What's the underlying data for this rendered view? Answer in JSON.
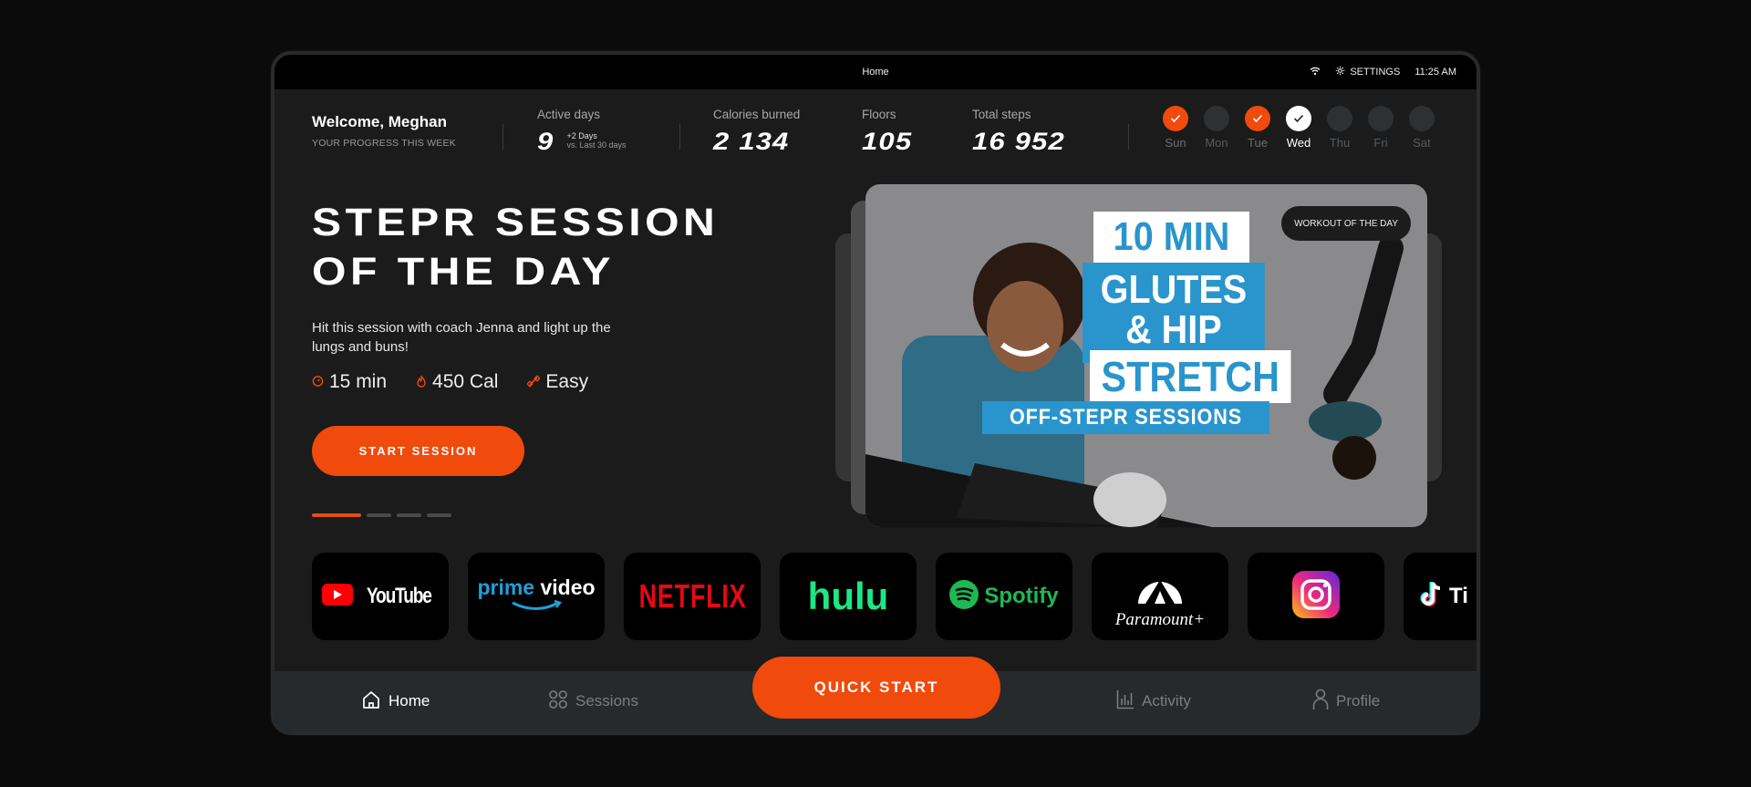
{
  "topbar": {
    "title": "Home",
    "wifi_icon": "wifi-icon",
    "settings_label": "SETTINGS",
    "time": "11:25 AM"
  },
  "welcome": {
    "greeting": "Welcome, Meghan",
    "subtitle": "YOUR PROGRESS THIS WEEK"
  },
  "stats": {
    "active_days": {
      "label": "Active days",
      "value": "9",
      "delta": "+2 Days",
      "compare": "vs. Last 30 days"
    },
    "calories": {
      "label": "Calories burned",
      "value": "2 134"
    },
    "floors": {
      "label": "Floors",
      "value": "105"
    },
    "steps": {
      "label": "Total steps",
      "value": "16 952"
    }
  },
  "week": [
    {
      "label": "Sun",
      "status": "done"
    },
    {
      "label": "Mon",
      "status": "none"
    },
    {
      "label": "Tue",
      "status": "done"
    },
    {
      "label": "Wed",
      "status": "today"
    },
    {
      "label": "Thu",
      "status": "none"
    },
    {
      "label": "Fri",
      "status": "none"
    },
    {
      "label": "Sat",
      "status": "none"
    }
  ],
  "hero": {
    "title_line1": "STEPR SESSION",
    "title_line2": "OF THE DAY",
    "description": "Hit this session with coach Jenna and light up the lungs and buns!",
    "duration": "15 min",
    "calories": "450 Cal",
    "difficulty": "Easy",
    "start_label": "START SESSION",
    "pager": {
      "count": 4,
      "active": 1
    },
    "card": {
      "badge": "WORKOUT OF THE DAY",
      "line1": "10 MIN",
      "line2": "GLUTES",
      "line3": "& HIP",
      "line4": "STRETCH",
      "line5": "OFF-STEPR SESSIONS"
    }
  },
  "apps": [
    {
      "name": "YouTube"
    },
    {
      "name": "prime video"
    },
    {
      "name": "NETFLIX"
    },
    {
      "name": "hulu"
    },
    {
      "name": "Spotify"
    },
    {
      "name": "Paramount+"
    },
    {
      "name": "Instagram"
    },
    {
      "name": "TikTok"
    }
  ],
  "nav": {
    "home": "Home",
    "sessions": "Sessions",
    "quick_start": "QUICK START",
    "activity": "Activity",
    "profile": "Profile"
  },
  "colors": {
    "accent": "#f04a0c",
    "background": "#1b1b1c",
    "navbar": "#262a2d"
  }
}
